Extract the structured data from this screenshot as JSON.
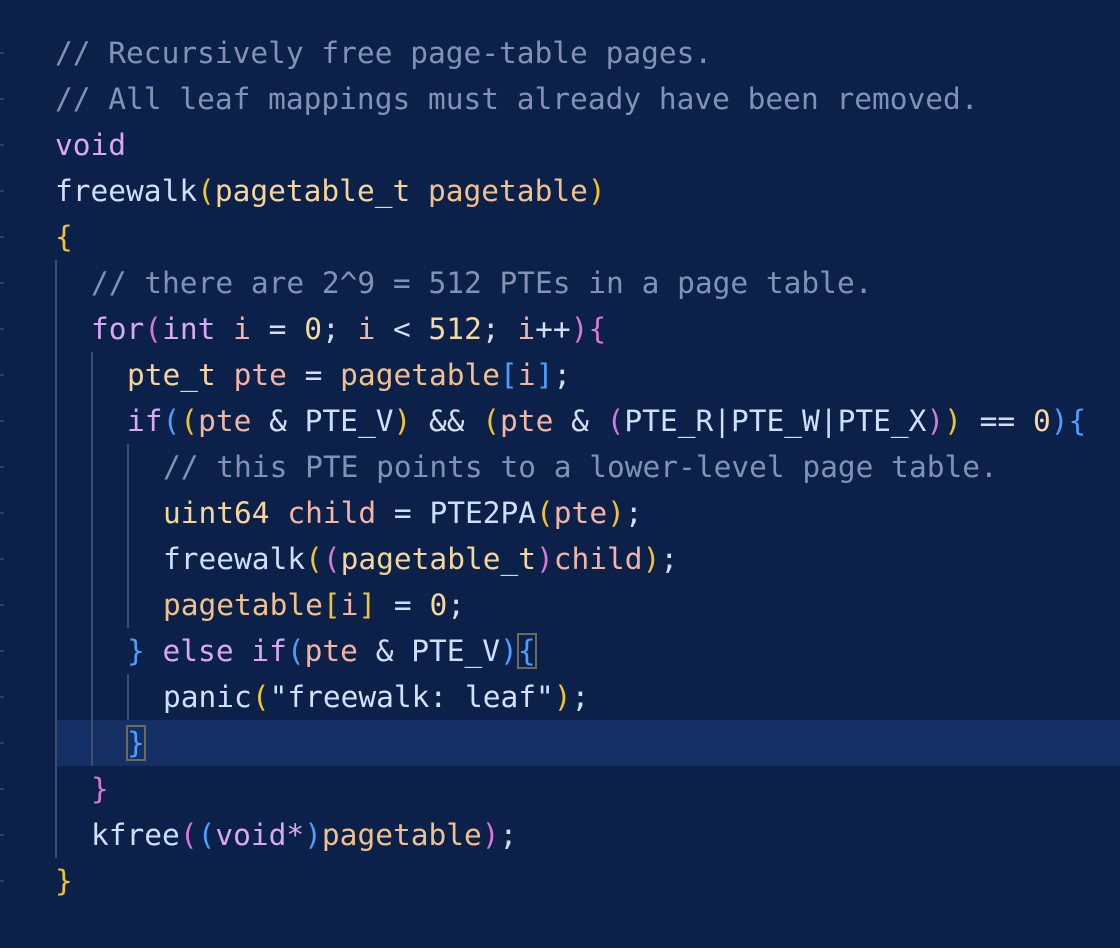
{
  "editor": {
    "language": "C",
    "lines": [
      {
        "indent": 0,
        "tokens": [
          {
            "t": "// Recursively free page-table pages.",
            "c": "tok-comment"
          }
        ]
      },
      {
        "indent": 0,
        "tokens": [
          {
            "t": "// All leaf mappings must already have been removed.",
            "c": "tok-comment"
          }
        ]
      },
      {
        "indent": 0,
        "tokens": [
          {
            "t": "void",
            "c": "tok-keyword"
          }
        ]
      },
      {
        "indent": 0,
        "tokens": [
          {
            "t": "freewalk",
            "c": "tok-fn"
          },
          {
            "t": "(",
            "c": "b1"
          },
          {
            "t": "pagetable_t",
            "c": "tok-type"
          },
          {
            "t": " ",
            "c": "tok-op"
          },
          {
            "t": "pagetable",
            "c": "tok-param"
          },
          {
            "t": ")",
            "c": "b1"
          }
        ]
      },
      {
        "indent": 0,
        "tokens": [
          {
            "t": "{",
            "c": "b1"
          }
        ]
      },
      {
        "indent": 1,
        "tokens": [
          {
            "t": "// there are 2^9 = 512 PTEs in a page table.",
            "c": "tok-comment"
          }
        ]
      },
      {
        "indent": 1,
        "tokens": [
          {
            "t": "for",
            "c": "tok-keyword"
          },
          {
            "t": "(",
            "c": "b2"
          },
          {
            "t": "int",
            "c": "tok-keyword"
          },
          {
            "t": " ",
            "c": "tok-op"
          },
          {
            "t": "i",
            "c": "tok-var"
          },
          {
            "t": " = ",
            "c": "tok-op"
          },
          {
            "t": "0",
            "c": "tok-num"
          },
          {
            "t": "; ",
            "c": "tok-punct"
          },
          {
            "t": "i",
            "c": "tok-var"
          },
          {
            "t": " < ",
            "c": "tok-op"
          },
          {
            "t": "512",
            "c": "tok-num"
          },
          {
            "t": "; ",
            "c": "tok-punct"
          },
          {
            "t": "i",
            "c": "tok-var"
          },
          {
            "t": "++",
            "c": "tok-op"
          },
          {
            "t": ")",
            "c": "b2"
          },
          {
            "t": "{",
            "c": "b2"
          }
        ]
      },
      {
        "indent": 2,
        "tokens": [
          {
            "t": "pte_t",
            "c": "tok-type"
          },
          {
            "t": " ",
            "c": "tok-op"
          },
          {
            "t": "pte",
            "c": "tok-var"
          },
          {
            "t": " = ",
            "c": "tok-op"
          },
          {
            "t": "pagetable",
            "c": "tok-param"
          },
          {
            "t": "[",
            "c": "b3"
          },
          {
            "t": "i",
            "c": "tok-var"
          },
          {
            "t": "]",
            "c": "b3"
          },
          {
            "t": ";",
            "c": "tok-punct"
          }
        ]
      },
      {
        "indent": 2,
        "tokens": [
          {
            "t": "if",
            "c": "tok-keyword"
          },
          {
            "t": "(",
            "c": "b3"
          },
          {
            "t": "(",
            "c": "b1"
          },
          {
            "t": "pte",
            "c": "tok-var"
          },
          {
            "t": " & ",
            "c": "tok-op"
          },
          {
            "t": "PTE_V",
            "c": "tok-const"
          },
          {
            "t": ")",
            "c": "b1"
          },
          {
            "t": " && ",
            "c": "tok-op"
          },
          {
            "t": "(",
            "c": "b1"
          },
          {
            "t": "pte",
            "c": "tok-var"
          },
          {
            "t": " & ",
            "c": "tok-op"
          },
          {
            "t": "(",
            "c": "b2"
          },
          {
            "t": "PTE_R",
            "c": "tok-const"
          },
          {
            "t": "|",
            "c": "tok-op"
          },
          {
            "t": "PTE_W",
            "c": "tok-const"
          },
          {
            "t": "|",
            "c": "tok-op"
          },
          {
            "t": "PTE_X",
            "c": "tok-const"
          },
          {
            "t": ")",
            "c": "b2"
          },
          {
            "t": ")",
            "c": "b1"
          },
          {
            "t": " == ",
            "c": "tok-op"
          },
          {
            "t": "0",
            "c": "tok-num"
          },
          {
            "t": ")",
            "c": "b3"
          },
          {
            "t": "{",
            "c": "b3"
          }
        ]
      },
      {
        "indent": 3,
        "tokens": [
          {
            "t": "// this PTE points to a lower-level page table.",
            "c": "tok-comment"
          }
        ]
      },
      {
        "indent": 3,
        "tokens": [
          {
            "t": "uint64",
            "c": "tok-type"
          },
          {
            "t": " ",
            "c": "tok-op"
          },
          {
            "t": "child",
            "c": "tok-var"
          },
          {
            "t": " = ",
            "c": "tok-op"
          },
          {
            "t": "PTE2PA",
            "c": "tok-fn"
          },
          {
            "t": "(",
            "c": "b1"
          },
          {
            "t": "pte",
            "c": "tok-var"
          },
          {
            "t": ")",
            "c": "b1"
          },
          {
            "t": ";",
            "c": "tok-punct"
          }
        ]
      },
      {
        "indent": 3,
        "tokens": [
          {
            "t": "freewalk",
            "c": "tok-fn"
          },
          {
            "t": "(",
            "c": "b1"
          },
          {
            "t": "(",
            "c": "b2"
          },
          {
            "t": "pagetable_t",
            "c": "tok-type"
          },
          {
            "t": ")",
            "c": "b2"
          },
          {
            "t": "child",
            "c": "tok-var"
          },
          {
            "t": ")",
            "c": "b1"
          },
          {
            "t": ";",
            "c": "tok-punct"
          }
        ]
      },
      {
        "indent": 3,
        "tokens": [
          {
            "t": "pagetable",
            "c": "tok-param"
          },
          {
            "t": "[",
            "c": "b1"
          },
          {
            "t": "i",
            "c": "tok-var"
          },
          {
            "t": "]",
            "c": "b1"
          },
          {
            "t": " = ",
            "c": "tok-op"
          },
          {
            "t": "0",
            "c": "tok-num"
          },
          {
            "t": ";",
            "c": "tok-punct"
          }
        ]
      },
      {
        "indent": 2,
        "tokens": [
          {
            "t": "}",
            "c": "b3"
          },
          {
            "t": " ",
            "c": "tok-op"
          },
          {
            "t": "else",
            "c": "tok-keyword"
          },
          {
            "t": " ",
            "c": "tok-op"
          },
          {
            "t": "if",
            "c": "tok-keyword"
          },
          {
            "t": "(",
            "c": "b3"
          },
          {
            "t": "pte",
            "c": "tok-var"
          },
          {
            "t": " & ",
            "c": "tok-op"
          },
          {
            "t": "PTE_V",
            "c": "tok-const"
          },
          {
            "t": ")",
            "c": "b3"
          },
          {
            "t": "{",
            "c": "b3 bracket-box"
          }
        ]
      },
      {
        "indent": 3,
        "tokens": [
          {
            "t": "panic",
            "c": "tok-fn"
          },
          {
            "t": "(",
            "c": "b1"
          },
          {
            "t": "\"freewalk: leaf\"",
            "c": "tok-str"
          },
          {
            "t": ")",
            "c": "b1"
          },
          {
            "t": ";",
            "c": "tok-punct"
          }
        ]
      },
      {
        "indent": 2,
        "tokens": [
          {
            "t": "}",
            "c": "b3 bracket-box"
          }
        ]
      },
      {
        "indent": 1,
        "tokens": [
          {
            "t": "}",
            "c": "b2"
          }
        ]
      },
      {
        "indent": 1,
        "tokens": [
          {
            "t": "kfree",
            "c": "tok-fn"
          },
          {
            "t": "(",
            "c": "b2"
          },
          {
            "t": "(",
            "c": "b3"
          },
          {
            "t": "void*",
            "c": "tok-keyword"
          },
          {
            "t": ")",
            "c": "b3"
          },
          {
            "t": "pagetable",
            "c": "tok-param"
          },
          {
            "t": ")",
            "c": "b2"
          },
          {
            "t": ";",
            "c": "tok-punct"
          }
        ]
      },
      {
        "indent": 0,
        "tokens": [
          {
            "t": "}",
            "c": "b1"
          }
        ]
      }
    ],
    "current_line_index": 15
  }
}
